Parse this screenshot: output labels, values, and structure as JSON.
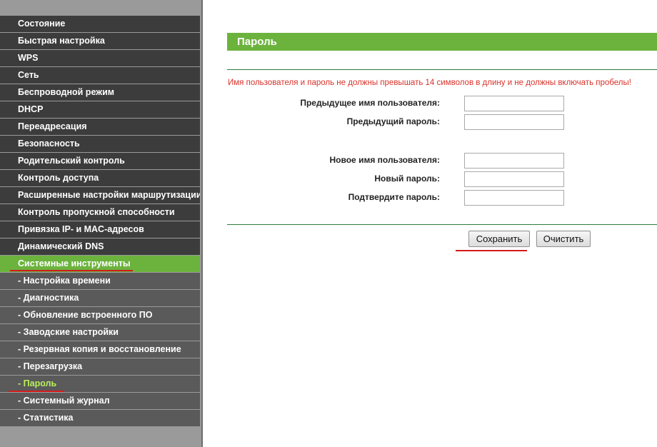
{
  "sidebar": {
    "items": [
      {
        "label": "Состояние"
      },
      {
        "label": "Быстрая настройка"
      },
      {
        "label": "WPS"
      },
      {
        "label": "Сеть"
      },
      {
        "label": "Беспроводной режим"
      },
      {
        "label": "DHCP"
      },
      {
        "label": "Переадресация"
      },
      {
        "label": "Безопасность"
      },
      {
        "label": "Родительский контроль"
      },
      {
        "label": "Контроль доступа"
      },
      {
        "label": "Расширенные настройки маршрутизации"
      },
      {
        "label": "Контроль пропускной способности"
      },
      {
        "label": "Привязка IP- и MAC-адресов"
      },
      {
        "label": "Динамический DNS"
      },
      {
        "label": "Системные инструменты"
      }
    ],
    "subitems": [
      {
        "label": "- Настройка времени"
      },
      {
        "label": "- Диагностика"
      },
      {
        "label": "- Обновление встроенного ПО"
      },
      {
        "label": "- Заводские настройки"
      },
      {
        "label": "- Резервная копия и восстановление"
      },
      {
        "label": "- Перезагрузка"
      },
      {
        "label": "- Пароль"
      },
      {
        "label": "- Системный журнал"
      },
      {
        "label": "- Статистика"
      }
    ],
    "active_section": "Системные инструменты",
    "active_item": "- Пароль"
  },
  "main": {
    "title": "Пароль",
    "notice": "Имя пользователя и пароль не должны превышать 14 символов в длину и не должны включать пробелы!",
    "fields": {
      "old_username": {
        "label": "Предыдущее имя пользователя:",
        "value": ""
      },
      "old_password": {
        "label": "Предыдущий пароль:",
        "value": ""
      },
      "new_username": {
        "label": "Новое имя пользователя:",
        "value": ""
      },
      "new_password": {
        "label": "Новый пароль:",
        "value": ""
      },
      "confirm_password": {
        "label": "Подтвердите пароль:",
        "value": ""
      }
    },
    "buttons": {
      "save": "Сохранить",
      "clear": "Очистить"
    }
  },
  "colors": {
    "accent_green": "#6cb33e",
    "nav_dark": "#3c3c3c",
    "nav_sub": "#5a5a5a",
    "notice_red": "#d9322a",
    "annotation_red": "#d41a1a",
    "active_text": "#b9f05a"
  }
}
